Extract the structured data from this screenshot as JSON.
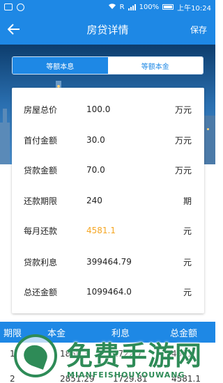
{
  "status_bar": {
    "carrier_letter": "R",
    "battery": "100%",
    "time": "上午10:24"
  },
  "app_bar": {
    "title": "房贷详情",
    "save_label": "保存"
  },
  "tabs": [
    {
      "label": "等额本息"
    },
    {
      "label": "等额本金"
    }
  ],
  "details": [
    {
      "label": "房屋总价",
      "value": "100.0",
      "unit": "万元"
    },
    {
      "label": "首付金额",
      "value": "30.0",
      "unit": "万元"
    },
    {
      "label": "贷款金额",
      "value": "70.0",
      "unit": "万元"
    },
    {
      "label": "还款期限",
      "value": "240",
      "unit": "期"
    },
    {
      "label": "每月还款",
      "value": "4581.1",
      "unit": "元"
    },
    {
      "label": "贷款利息",
      "value": "399464.79",
      "unit": "元"
    },
    {
      "label": "总还金额",
      "value": "1099464.0",
      "unit": "元"
    }
  ],
  "schedule": {
    "headers": [
      "期限",
      "本金",
      "利息",
      "总金额"
    ],
    "rows": [
      [
        "1",
        "1858.3",
        "2722.7",
        "4581"
      ],
      [
        "2",
        "2851.29",
        "1729.81",
        "4581.1"
      ]
    ]
  },
  "watermark": {
    "text": "免费手游网",
    "subtext": "MIANFEISHOUYOUWANG"
  },
  "colors": {
    "primary": "#1e88e5",
    "highlight": "#f5a623",
    "watermark": "#2e8b57"
  }
}
